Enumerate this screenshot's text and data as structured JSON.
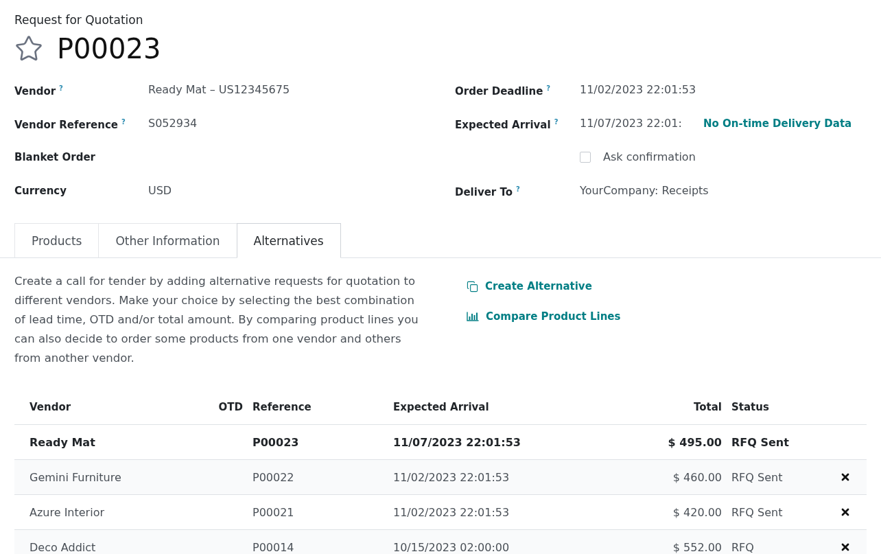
{
  "header": {
    "breadcrumb": "Request for Quotation",
    "title": "P00023",
    "starred": false
  },
  "fields_left": [
    {
      "label": "Vendor",
      "help": "?",
      "value": "Ready Mat – US12345675"
    },
    {
      "label": "Vendor Reference",
      "help": "?",
      "value": "S052934"
    },
    {
      "label": "Blanket Order"
    },
    {
      "label": "Currency",
      "value": "USD"
    }
  ],
  "fields_right": [
    {
      "kind": "text",
      "label": "Order Deadline",
      "help": "?",
      "value": "11/02/2023 22:01:53"
    },
    {
      "kind": "text",
      "label": "Expected Arrival",
      "help": "?",
      "value": "11/07/2023 22:01:",
      "note": "No On-time Delivery Data"
    },
    {
      "kind": "checkbox",
      "label": "Ask confirmation",
      "checked": false
    },
    {
      "kind": "text",
      "label": "Deliver To",
      "help": "?",
      "value": "YourCompany: Receipts"
    }
  ],
  "tabs": [
    {
      "label": "Products",
      "selected": false
    },
    {
      "label": "Other Information",
      "selected": false
    },
    {
      "label": "Alternatives",
      "selected": true
    }
  ],
  "alternatives": {
    "description": "Create a call for tender by adding alternative requests for quotation to different vendors. Make your choice by selecting the best combination of lead time, OTD and/or total amount. By comparing product lines you can also decide to order some products from one vendor and others from another vendor.",
    "actions": [
      {
        "kind": "create",
        "label": "Create Alternative"
      },
      {
        "kind": "compare",
        "label": "Compare Product Lines"
      }
    ],
    "table": {
      "columns": [
        {
          "kind": "text",
          "label": "Vendor"
        },
        {
          "kind": "number",
          "label": "OTD"
        },
        {
          "kind": "text",
          "label": "Reference"
        },
        {
          "kind": "text",
          "label": "Expected Arrival"
        },
        {
          "kind": "number",
          "label": "Total"
        },
        {
          "kind": "text",
          "label": "Status"
        }
      ],
      "rows": [
        {
          "vendor": "Ready Mat",
          "reference": "P00023",
          "expected_arrival": "11/07/2023 22:01:53",
          "total": "$ 495.00",
          "status": "RFQ Sent",
          "current": true,
          "removable": false
        },
        {
          "vendor": "Gemini Furniture",
          "reference": "P00022",
          "expected_arrival": "11/02/2023 22:01:53",
          "total": "$ 460.00",
          "status": "RFQ Sent",
          "current": false,
          "removable": true
        },
        {
          "vendor": "Azure Interior",
          "reference": "P00021",
          "expected_arrival": "11/02/2023 22:01:53",
          "total": "$ 420.00",
          "status": "RFQ Sent",
          "current": false,
          "removable": true
        },
        {
          "vendor": "Deco Addict",
          "reference": "P00014",
          "expected_arrival": "10/15/2023 02:00:00",
          "total": "$ 552.00",
          "status": "RFQ",
          "current": false,
          "removable": true
        }
      ]
    }
  }
}
